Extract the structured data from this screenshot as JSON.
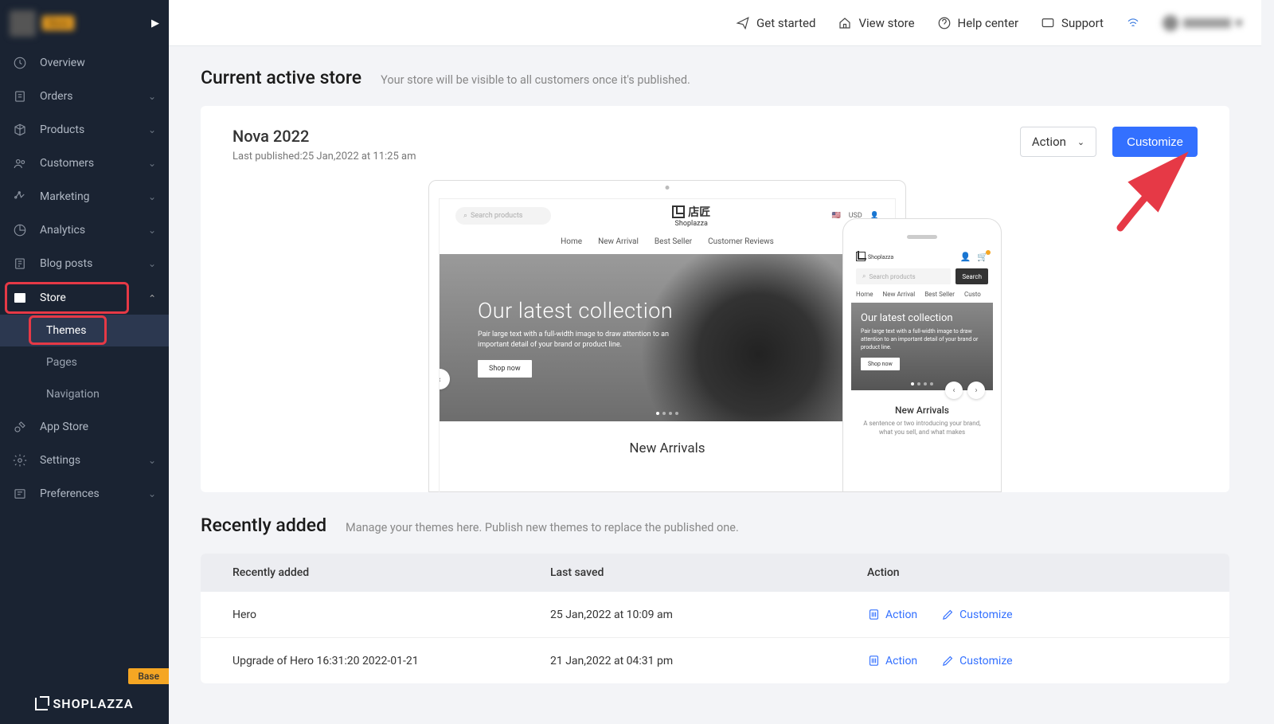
{
  "sidebar": {
    "items": [
      {
        "label": "Overview",
        "chevron": false
      },
      {
        "label": "Orders",
        "chevron": true
      },
      {
        "label": "Products",
        "chevron": true
      },
      {
        "label": "Customers",
        "chevron": true
      },
      {
        "label": "Marketing",
        "chevron": true
      },
      {
        "label": "Analytics",
        "chevron": true
      },
      {
        "label": "Blog posts",
        "chevron": true
      },
      {
        "label": "Store",
        "chevron": true
      },
      {
        "label": "App Store",
        "chevron": false
      },
      {
        "label": "Settings",
        "chevron": true
      },
      {
        "label": "Preferences",
        "chevron": true
      }
    ],
    "sub_items": [
      "Themes",
      "Pages",
      "Navigation"
    ],
    "base_tag": "Base",
    "brand": "SHOPLAZZA"
  },
  "topbar": {
    "get_started": "Get started",
    "view_store": "View store",
    "help_center": "Help center",
    "support": "Support"
  },
  "current": {
    "title": "Current active store",
    "subtitle": "Your store will be visible to all customers once it's published.",
    "theme_name": "Nova 2022",
    "last_published": "Last published:25 Jan,2022 at 11:25 am",
    "action_label": "Action",
    "customize_label": "Customize"
  },
  "preview": {
    "search_placeholder": "Search products",
    "logo_text": "店匠",
    "logo_sub": "Shoplazza",
    "currency": "USD",
    "nav": [
      "Home",
      "New Arrival",
      "Best Seller",
      "Customer Reviews"
    ],
    "hero_title": "Our latest collection",
    "hero_sub": "Pair large text with a full-width image to draw attention to an important detail of your brand or product line.",
    "hero_btn": "Shop now",
    "new_arrivals": "New Arrivals",
    "mobile": {
      "nav": [
        "Home",
        "New Arrival",
        "Best Seller",
        "Custo"
      ],
      "search_btn": "Search",
      "hero_title": "Our latest collection",
      "hero_sub": "Pair large text with a full-width image to draw attention to an important detail of your brand or product line.",
      "hero_btn": "Shop now",
      "new_arrivals": "New Arrivals",
      "desc": "A sentence or two introducing your brand, what you sell, and what makes"
    }
  },
  "recent": {
    "title": "Recently added",
    "subtitle": "Manage your themes here. Publish new themes to replace the published one.",
    "headers": [
      "Recently added",
      "Last saved",
      "Action"
    ],
    "rows": [
      {
        "name": "Hero",
        "saved": "25 Jan,2022 at 10:09 am"
      },
      {
        "name": "Upgrade of Hero 16:31:20 2022-01-21",
        "saved": "21 Jan,2022 at 04:31 pm"
      }
    ],
    "action_label": "Action",
    "customize_label": "Customize"
  }
}
